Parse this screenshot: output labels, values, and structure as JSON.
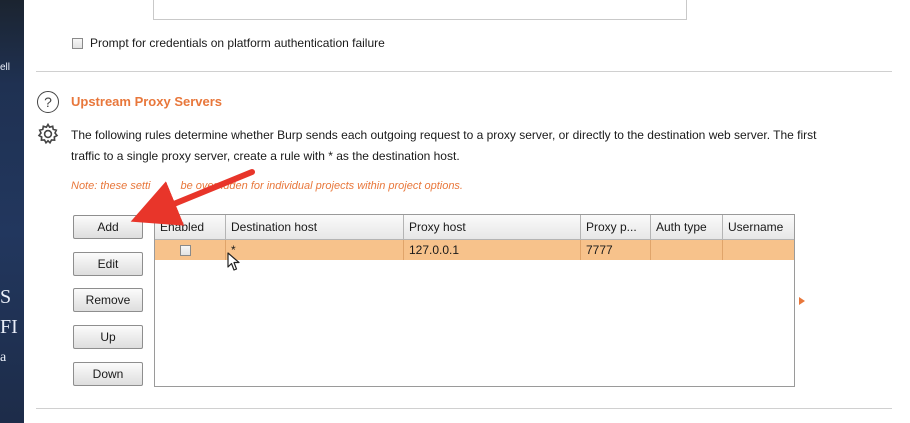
{
  "left_strip": {
    "lines": [
      "ell",
      "S",
      "FI",
      "a"
    ]
  },
  "prompt_checkbox": {
    "label": "Prompt for credentials on platform authentication failure",
    "checked": false
  },
  "section": {
    "title": "Upstream Proxy Servers",
    "description_line1": "The following rules determine whether Burp sends each outgoing request to a proxy server, or directly to the destination web server. The first",
    "description_line2": "traffic to a single proxy server, create a rule with * as the destination host.",
    "note_part1": "Note: these setti",
    "note_part2": "be overridden for individual projects within project options."
  },
  "buttons": {
    "add": "Add",
    "edit": "Edit",
    "remove": "Remove",
    "up": "Up",
    "down": "Down"
  },
  "table": {
    "columns": [
      "Enabled",
      "Destination host",
      "Proxy host",
      "Proxy p...",
      "Auth type",
      "Username"
    ],
    "rows": [
      {
        "enabled": false,
        "destination_host": "*",
        "proxy_host": "127.0.0.1",
        "proxy_port": "7777",
        "auth_type": "",
        "username": ""
      }
    ]
  },
  "colors": {
    "accent": "#e8773b",
    "selected_row": "#f7c28b",
    "annotation_arrow": "#e8352a"
  },
  "icons": {
    "help": "help-circle-icon",
    "settings": "gear-icon",
    "pointer": "mouse-cursor-icon",
    "annotation": "red-arrow-annotation"
  }
}
